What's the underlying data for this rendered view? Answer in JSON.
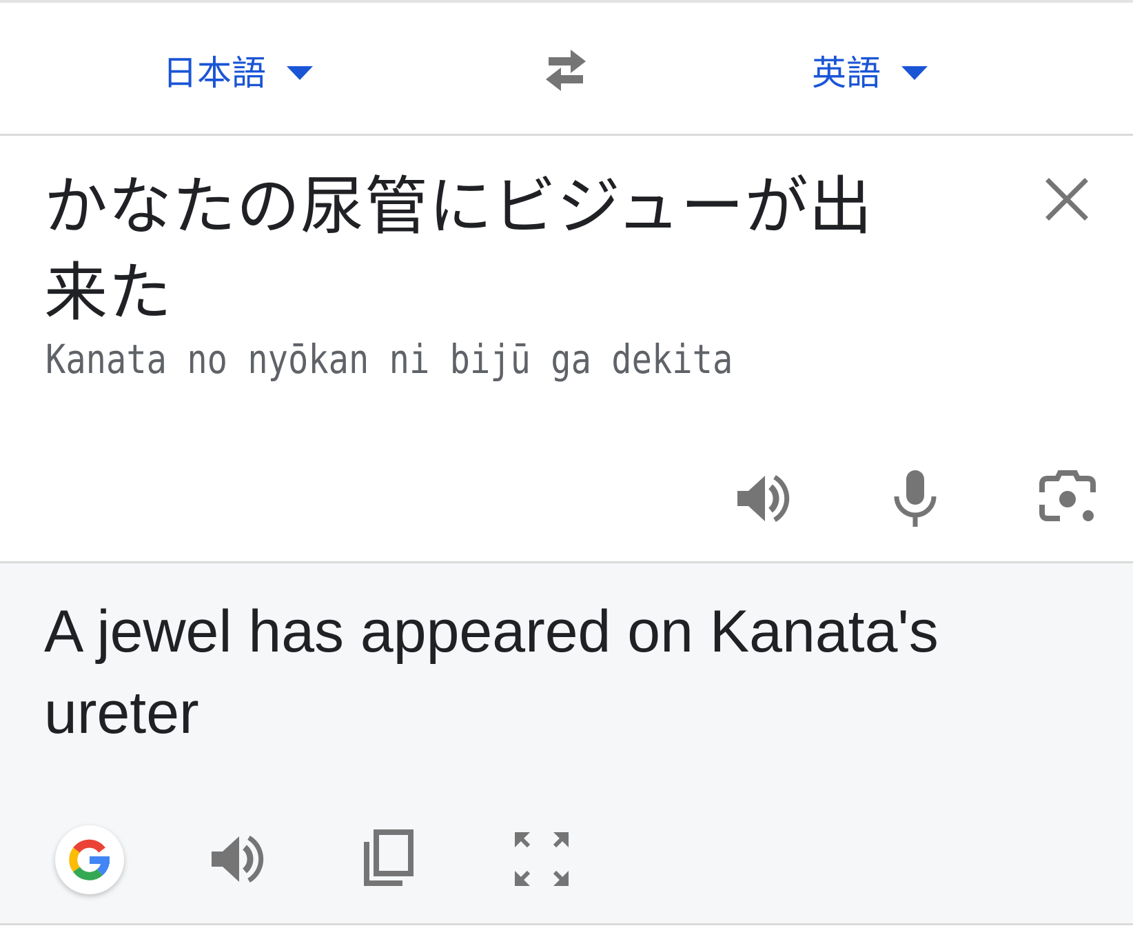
{
  "language_bar": {
    "source_language": "日本語",
    "target_language": "英語",
    "swap_icon": "swap-arrows-icon"
  },
  "source": {
    "text": "かなたの尿管にビジューが出来た",
    "romanization": "Kanata no nyōkan ni bijū ga dekita",
    "icons": [
      "clear-icon",
      "speaker-icon",
      "microphone-icon",
      "camera-icon"
    ]
  },
  "translation": {
    "text": "A jewel has appeared on Kanata's ureter",
    "icons": [
      "google-logo",
      "speaker-icon",
      "copy-icon",
      "fullscreen-icon"
    ]
  },
  "colors": {
    "accent": "#1a55d6",
    "icon_gray": "#757575",
    "result_background": "#f5f7f9"
  }
}
